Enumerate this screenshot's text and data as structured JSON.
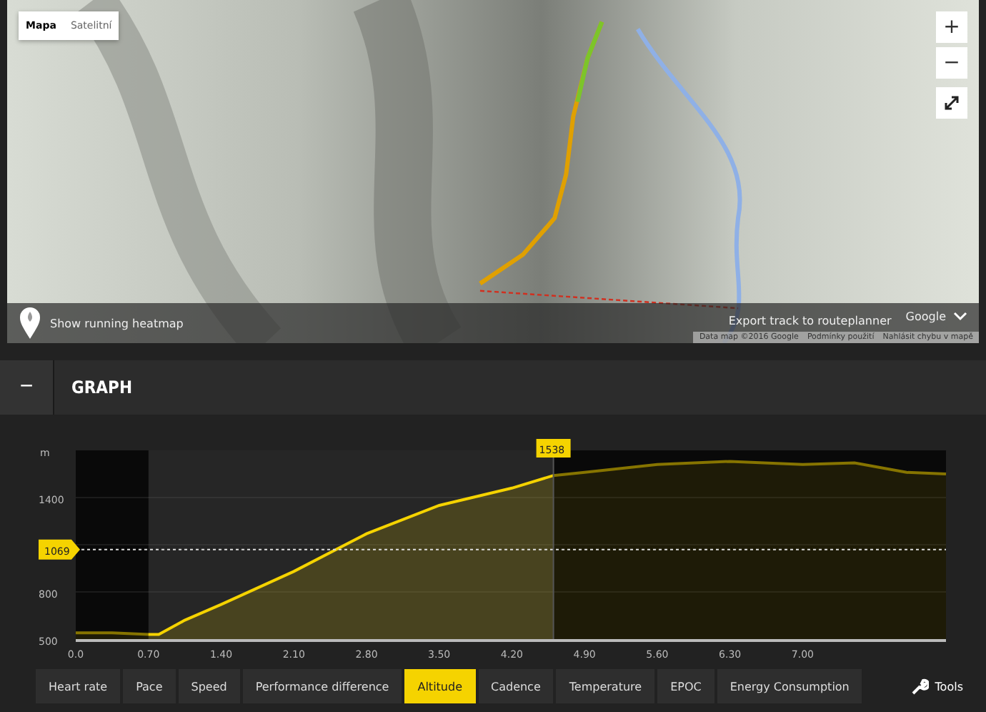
{
  "map": {
    "view_tabs": [
      {
        "label": "Mapa",
        "selected": true
      },
      {
        "label": "Satelitní",
        "selected": false
      }
    ],
    "zoom_in": "+",
    "zoom_out": "−",
    "heatmap_toggle": {
      "label": "Show running heatmap",
      "on": false
    },
    "export_link": "Export track to routeplanner",
    "provider_menu": "Google",
    "footer": [
      "Data map ©2016 Google",
      "Podmínky použití",
      "Nahlásit chybu v mapě"
    ]
  },
  "graph": {
    "collapse_button": "−",
    "title": "GRAPH",
    "chart_data": {
      "type": "area",
      "ylabel": "m",
      "x": [
        0,
        0.35,
        0.7,
        0.8,
        1.05,
        1.4,
        2.1,
        2.8,
        3.5,
        4.2,
        4.6,
        4.9,
        5.6,
        6.3,
        7.0,
        7.5,
        8.0,
        8.38
      ],
      "series": [
        {
          "color": "#f5d300",
          "values": [
            540,
            540,
            530,
            530,
            620,
            720,
            930,
            1170,
            1350,
            1460,
            1540,
            1560,
            1610,
            1630,
            1610,
            1620,
            1560,
            1550
          ]
        }
      ],
      "xlim": [
        0,
        8.38
      ],
      "ylim": [
        500,
        1700
      ],
      "xticks": [
        {
          "value": 0,
          "label": "0.0"
        },
        {
          "value": 0.7,
          "label": "0.70"
        },
        {
          "value": 1.4,
          "label": "1.40"
        },
        {
          "value": 2.1,
          "label": "2.10"
        },
        {
          "value": 2.8,
          "label": "2.80"
        },
        {
          "value": 3.5,
          "label": "3.50"
        },
        {
          "value": 4.2,
          "label": "4.20"
        },
        {
          "value": 4.9,
          "label": "4.90"
        },
        {
          "value": 5.6,
          "label": "5.60"
        },
        {
          "value": 6.3,
          "label": "6.30"
        },
        {
          "value": 7.0,
          "label": "7.00"
        }
      ],
      "yticks": [
        500,
        800,
        1400
      ],
      "ref_lines": [
        {
          "axis": "y",
          "value": 1069,
          "label": "1069"
        },
        {
          "axis": "x",
          "value": 4.6
        }
      ]
    },
    "cursor_readout": "1538",
    "tabs": [
      {
        "label": "Heart rate",
        "selected": false
      },
      {
        "label": "Pace",
        "selected": false
      },
      {
        "label": "Speed",
        "selected": false
      },
      {
        "label": "Performance difference",
        "selected": false
      },
      {
        "label": "Altitude",
        "selected": true
      },
      {
        "label": "Cadence",
        "selected": false
      },
      {
        "label": "Temperature",
        "selected": false
      },
      {
        "label": "EPOC",
        "selected": false
      },
      {
        "label": "Energy Consumption",
        "selected": false
      }
    ],
    "tools_button": "Tools"
  }
}
